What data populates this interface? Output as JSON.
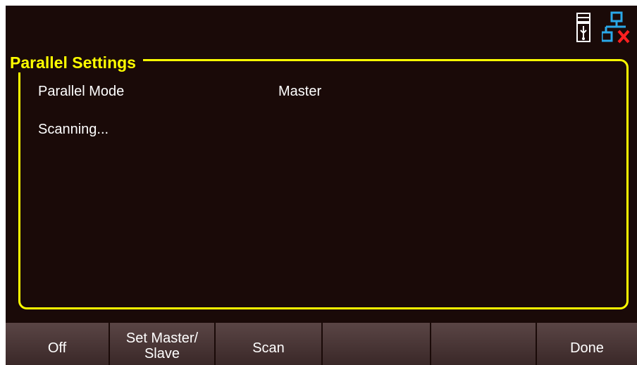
{
  "status_bar": {
    "icons": [
      "usb-icon",
      "lan-disconnected-icon"
    ],
    "colors": {
      "lan": "#2aa8e8",
      "lan_error": "#ff2020"
    }
  },
  "panel": {
    "title": "Parallel Settings",
    "mode_label": "Parallel Mode",
    "mode_value": "Master",
    "status_text": "Scanning..."
  },
  "softkeys": [
    {
      "label": "Off"
    },
    {
      "line1": "Set Master/",
      "line2": "Slave"
    },
    {
      "label": "Scan"
    },
    {
      "label": ""
    },
    {
      "label": ""
    },
    {
      "label": "Done"
    }
  ],
  "colors": {
    "background": "#1a0a08",
    "accent": "#ffff00",
    "text": "#ffffff",
    "softkey": "#4a3535"
  }
}
